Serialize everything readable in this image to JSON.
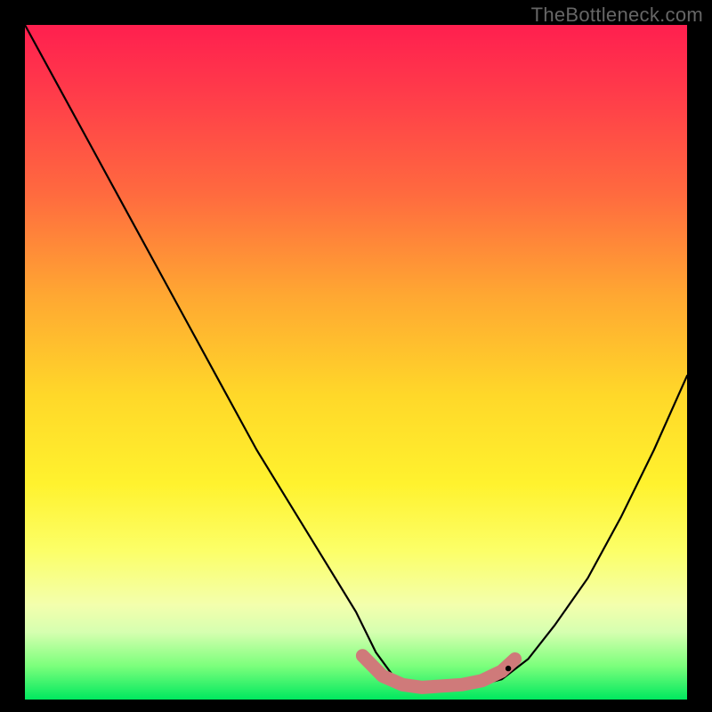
{
  "watermark": "TheBottleneck.com",
  "chart_data": {
    "type": "line",
    "title": "",
    "xlabel": "",
    "ylabel": "",
    "xlim": [
      0,
      1
    ],
    "ylim": [
      0,
      1
    ],
    "series": [
      {
        "name": "bottleneck-curve",
        "x": [
          0.0,
          0.05,
          0.1,
          0.15,
          0.2,
          0.25,
          0.3,
          0.35,
          0.4,
          0.45,
          0.5,
          0.53,
          0.56,
          0.6,
          0.64,
          0.68,
          0.72,
          0.76,
          0.8,
          0.85,
          0.9,
          0.95,
          1.0
        ],
        "y": [
          1.0,
          0.91,
          0.82,
          0.73,
          0.64,
          0.55,
          0.46,
          0.37,
          0.29,
          0.21,
          0.13,
          0.07,
          0.03,
          0.015,
          0.02,
          0.02,
          0.03,
          0.06,
          0.11,
          0.18,
          0.27,
          0.37,
          0.48
        ]
      },
      {
        "name": "pink-floor-highlight",
        "x": [
          0.51,
          0.54,
          0.57,
          0.6,
          0.63,
          0.66,
          0.69,
          0.72,
          0.74
        ],
        "y": [
          0.065,
          0.035,
          0.022,
          0.018,
          0.02,
          0.022,
          0.028,
          0.042,
          0.06
        ]
      }
    ],
    "gradient_colors": {
      "top": "#ff1f4f",
      "mid_high": "#ffa732",
      "mid": "#fff22e",
      "mid_low": "#d6ffb0",
      "bottom": "#00e85f"
    }
  }
}
